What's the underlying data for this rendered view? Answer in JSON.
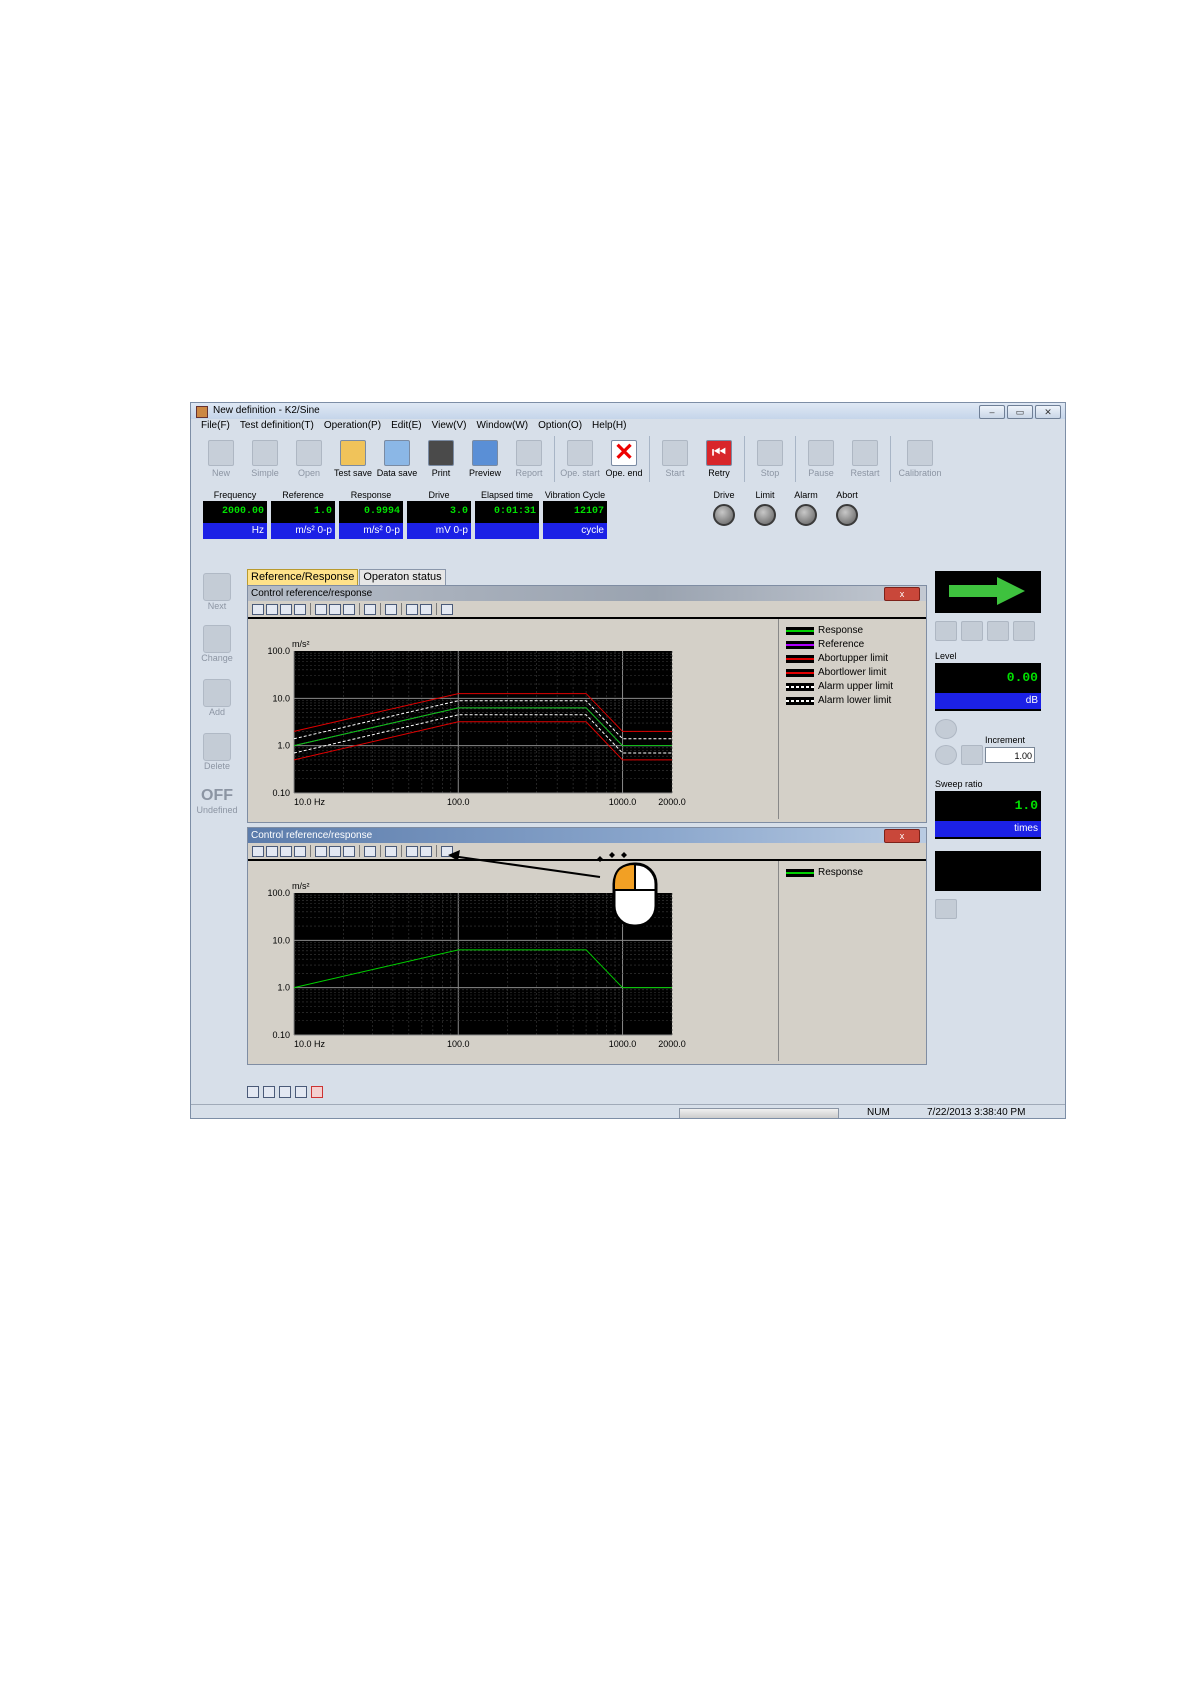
{
  "window": {
    "title": "New definition - K2/Sine"
  },
  "menu": [
    "File(F)",
    "Test definition(T)",
    "Operation(P)",
    "Edit(E)",
    "View(V)",
    "Window(W)",
    "Option(O)",
    "Help(H)"
  ],
  "toolbar": {
    "new": "New",
    "simple": "Simple",
    "open": "Open",
    "test_save": "Test save",
    "data_save": "Data save",
    "print": "Print",
    "preview": "Preview",
    "report": "Report",
    "ope_start": "Ope. start",
    "ope_end": "Ope. end",
    "start": "Start",
    "retry": "Retry",
    "stop": "Stop",
    "pause": "Pause",
    "restart": "Restart",
    "calibration": "Calibration"
  },
  "meters": [
    {
      "label": "Frequency",
      "value": "2000.00",
      "unit": "Hz"
    },
    {
      "label": "Reference",
      "value": "1.0",
      "unit": "m/s² 0-p"
    },
    {
      "label": "Response",
      "value": "0.9994",
      "unit": "m/s² 0-p"
    },
    {
      "label": "Drive",
      "value": "3.0",
      "unit": "mV 0-p"
    },
    {
      "label": "Elapsed time",
      "value": "0:01:31",
      "unit": ""
    },
    {
      "label": "Vibration Cycle",
      "value": "12107",
      "unit": "cycle"
    }
  ],
  "lamps": [
    "Drive",
    "Limit",
    "Alarm",
    "Abort"
  ],
  "left_panel": {
    "next": "Next",
    "change": "Change",
    "add": "Add",
    "delete": "Delete",
    "off": "OFF",
    "undefined": "Undefined"
  },
  "tabs": [
    "Reference/Response",
    "Operaton status"
  ],
  "plot1": {
    "title": "Control reference/response",
    "close": "x",
    "legend": [
      {
        "name": "Response",
        "color": "#00d000"
      },
      {
        "name": "Reference",
        "color": "#b000ff"
      },
      {
        "name": "Abortupper limit",
        "color": "#e00000"
      },
      {
        "name": "Abortlower limit",
        "color": "#e00000"
      },
      {
        "name": "Alarm upper limit",
        "color": "#ffffff"
      },
      {
        "name": "Alarm lower limit",
        "color": "#ffffff"
      }
    ]
  },
  "plot2": {
    "title": "Control reference/response",
    "close": "x",
    "legend": [
      {
        "name": "Response",
        "color": "#00d000"
      }
    ]
  },
  "axis": {
    "y_unit": "m/s²",
    "y_ticks": [
      "100.0",
      "10.0",
      "1.0",
      "0.10"
    ],
    "x_ticks": [
      "10.0 Hz",
      "100.0",
      "1000.0",
      "2000.0"
    ]
  },
  "chart_data": [
    {
      "type": "line",
      "title": "Control reference/response",
      "xscale": "log",
      "yscale": "log",
      "xlim": [
        10,
        2000
      ],
      "ylim": [
        0.1,
        100
      ],
      "grid": true,
      "legend": "right",
      "series": [
        {
          "name": "Response",
          "x": [
            10,
            100,
            600,
            1000,
            2000
          ],
          "y": [
            1.0,
            6.3,
            6.3,
            1.0,
            1.0
          ]
        },
        {
          "name": "Reference",
          "x": [
            10,
            100,
            600,
            1000,
            2000
          ],
          "y": [
            1.0,
            6.3,
            6.3,
            1.0,
            1.0
          ]
        },
        {
          "name": "Abortupper limit",
          "x": [
            10,
            100,
            600,
            1000,
            2000
          ],
          "y": [
            2.0,
            12.6,
            12.6,
            2.0,
            2.0
          ]
        },
        {
          "name": "Abortlower limit",
          "x": [
            10,
            100,
            600,
            1000,
            2000
          ],
          "y": [
            0.5,
            3.2,
            3.2,
            0.5,
            0.5
          ]
        },
        {
          "name": "Alarm upper limit",
          "x": [
            10,
            100,
            600,
            1000,
            2000
          ],
          "y": [
            1.4,
            8.9,
            8.9,
            1.4,
            1.4
          ]
        },
        {
          "name": "Alarm lower limit",
          "x": [
            10,
            100,
            600,
            1000,
            2000
          ],
          "y": [
            0.7,
            4.5,
            4.5,
            0.7,
            0.7
          ]
        }
      ]
    },
    {
      "type": "line",
      "title": "Control reference/response",
      "xscale": "log",
      "yscale": "log",
      "xlim": [
        10,
        2000
      ],
      "ylim": [
        0.1,
        100
      ],
      "grid": true,
      "legend": "right",
      "series": [
        {
          "name": "Response",
          "x": [
            10,
            100,
            600,
            1000,
            2000
          ],
          "y": [
            1.0,
            6.3,
            6.3,
            1.0,
            1.0
          ]
        }
      ]
    }
  ],
  "right_panel": {
    "level_label": "Level",
    "level_value": "0.00",
    "level_unit": "dB",
    "increment_label": "Increment",
    "increment_value": "1.00",
    "sweep_label": "Sweep ratio",
    "sweep_value": "1.0",
    "sweep_unit": "times"
  },
  "statusbar": {
    "num": "NUM",
    "datetime": "7/22/2013  3:38:40 PM"
  }
}
